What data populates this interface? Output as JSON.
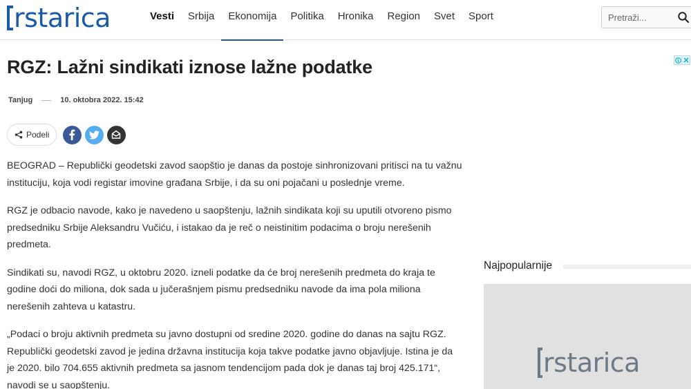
{
  "logo": {
    "text": "rstarica"
  },
  "nav": {
    "items": [
      {
        "label": "Vesti",
        "bold": true,
        "active": false
      },
      {
        "label": "Srbija",
        "bold": false,
        "active": false
      },
      {
        "label": "Ekonomija",
        "bold": false,
        "active": true
      },
      {
        "label": "Politika",
        "bold": false,
        "active": false
      },
      {
        "label": "Hronika",
        "bold": false,
        "active": false
      },
      {
        "label": "Region",
        "bold": false,
        "active": false
      },
      {
        "label": "Svet",
        "bold": false,
        "active": false
      },
      {
        "label": "Sport",
        "bold": false,
        "active": false
      }
    ]
  },
  "search": {
    "placeholder": "Pretraži..."
  },
  "article": {
    "title": "RGZ: Lažni sindikati iznose lažne podatke",
    "source": "Tanjug",
    "date": "10. oktobra 2022. 15:42",
    "share_label": "Podeli",
    "paragraphs": [
      "BEOGRAD – Republički geodetski zavod saopštio je danas da postoje sinhronizovani pritisci na tu važnu instituciju, koja vodi registar imovine građana Srbije, i da su oni pojačani u poslednje vreme.",
      "RGZ je odbacio navode, kako je navedeno u saopštenju, lažnih sindikata koji su uputili otvoreno pismo predsedniku Srbije Aleksandru Vučiću, i istakao da je reč o neistinitim podacima o broju nerešenih predmeta.",
      "Sindikati su, navodi RGZ, u oktobru 2020. izneli podatke da će broj nerešenih predmeta do kraja te godine doći do miliona, dok sada u jučerašnjem pismu predsedniku navode da ima pola miliona nerešenih zahteva u katastru.",
      "„Podaci o broju aktivnih predmeta su javno dostupni od sredine 2020. godine do danas na sajtu RGZ. Republički geodetski zavod je jedina državna institucija koja takve podatke javno objavljuje. Istina je da je 2020. bilo 704.655 aktivnih predmeta sa jasnom tendencijom pada dok je danas taj broj 425.171“, navodi se u saopštenju."
    ]
  },
  "sidebar": {
    "popular_title": "Najpopularnije",
    "image_logo_text": "rstarica"
  },
  "colors": {
    "brand": "#1a5aa8",
    "facebook": "#3b5998",
    "twitter": "#55acee",
    "mail": "#333333"
  }
}
